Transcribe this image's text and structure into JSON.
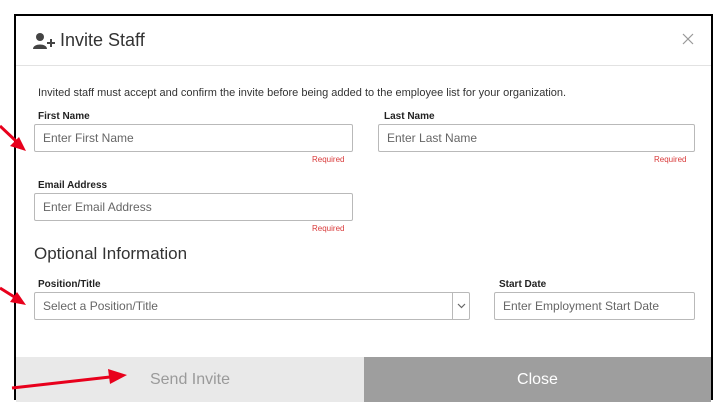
{
  "dialog": {
    "title": "Invite Staff",
    "title_icon": "add-user-icon",
    "close_icon": "close-icon"
  },
  "intro_text": "Invited staff must accept and confirm the invite before being added to the employee list for your organization.",
  "fields": {
    "first_name": {
      "label": "First Name",
      "placeholder": "Enter First Name",
      "required_text": "Required"
    },
    "last_name": {
      "label": "Last Name",
      "placeholder": "Enter Last Name",
      "required_text": "Required"
    },
    "email": {
      "label": "Email Address",
      "placeholder": "Enter Email Address",
      "required_text": "Required"
    }
  },
  "optional": {
    "heading": "Optional Information",
    "position": {
      "label": "Position/Title",
      "selected": "Select a Position/Title"
    },
    "start_date": {
      "label": "Start Date",
      "placeholder": "Enter Employment Start Date"
    }
  },
  "footer": {
    "send_label": "Send Invite",
    "close_label": "Close"
  },
  "colors": {
    "annotation_arrow": "#e8001c",
    "required": "#d93a3a",
    "close_button_bg": "#9e9e9e",
    "send_button_bg": "#e9e9e9"
  }
}
